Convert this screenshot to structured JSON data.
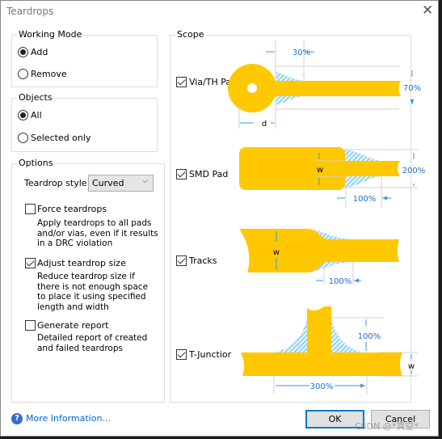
{
  "window": {
    "title": "Teardrops",
    "close_icon": "close-x-icon"
  },
  "working_mode": {
    "label": "Working Mode",
    "options": [
      "Add",
      "Remove"
    ],
    "selected": "Add"
  },
  "objects": {
    "label": "Objects",
    "options": [
      "All",
      "Selected only"
    ],
    "selected": "All"
  },
  "options": {
    "label": "Options",
    "style_label": "Teardrop style",
    "style_value": "Curved",
    "force": {
      "label": "Force teardrops",
      "checked": false,
      "desc": [
        "Apply teardrops to all pads",
        "and/or vias, even if it results",
        "in a DRC violation"
      ]
    },
    "adjust": {
      "label": "Adjust teardrop size",
      "checked": true,
      "desc": [
        "Reduce teardrop size if",
        "there is not enough space",
        "to place it using specified",
        "length and width"
      ]
    },
    "report": {
      "label": "Generate report",
      "checked": false,
      "desc": [
        "Detailed report of created",
        "and failed teardrops"
      ]
    }
  },
  "scope": {
    "label": "Scope",
    "via": {
      "label": "Via/TH Pad",
      "checked": true,
      "length": "30%",
      "width": "70%",
      "dim": "d"
    },
    "smd": {
      "label": "SMD Pad",
      "checked": true,
      "length": "100%",
      "width": "200%",
      "dim": "w"
    },
    "tracks": {
      "label": "Tracks",
      "checked": true,
      "length": "100%",
      "dim": "w"
    },
    "tjunction": {
      "label": "T-Junctior",
      "checked": true,
      "length": "300%",
      "height": "100%",
      "dim": "w"
    }
  },
  "footer": {
    "more_info": "More Information...",
    "ok": "OK",
    "cancel": "Cancel",
    "watermark": "CSDN @*真空*"
  },
  "colors": {
    "copper": "#ffc800",
    "hatch": "#3aa0d8",
    "dim": "#1a6fd0",
    "link": "#0066cc"
  }
}
